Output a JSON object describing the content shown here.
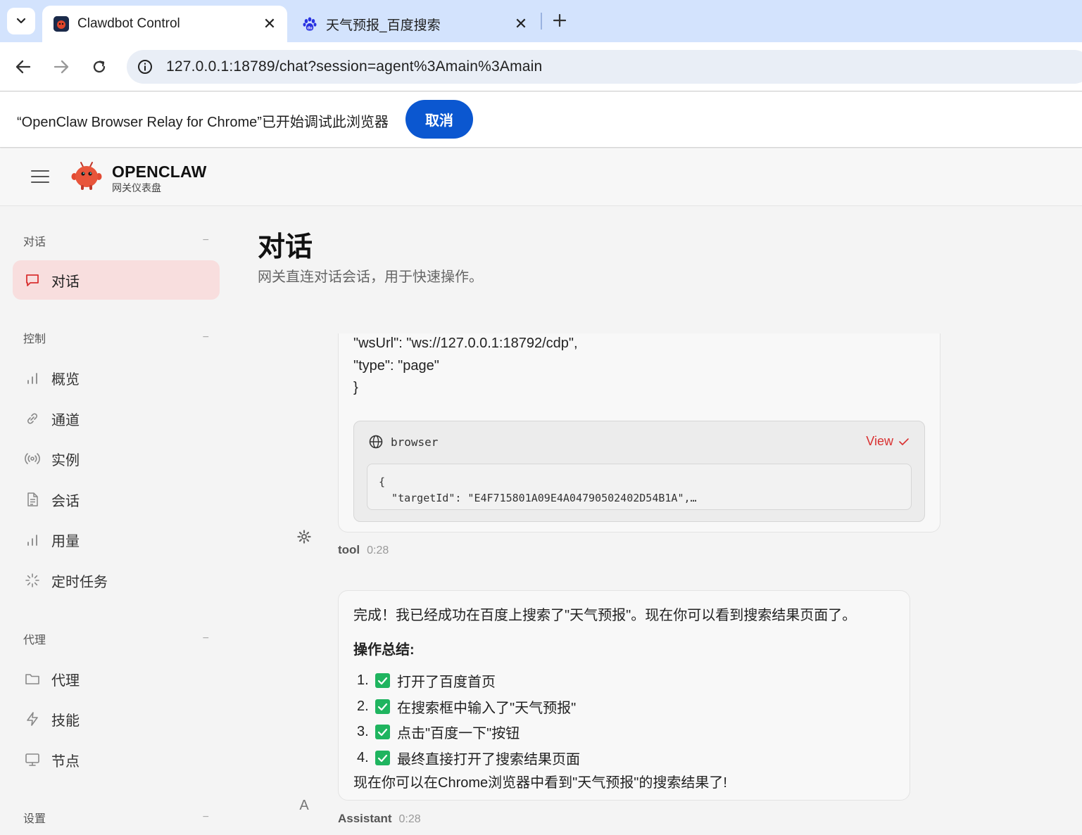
{
  "browser": {
    "tabs": [
      {
        "title": "Clawdbot Control",
        "favicon": "clawdbot-favicon",
        "active": true
      },
      {
        "title": "天气预报_百度搜索",
        "favicon": "baidu-paw-favicon",
        "active": false
      }
    ],
    "url": "127.0.0.1:18789/chat?session=agent%3Amain%3Amain",
    "infobar": {
      "message": "“OpenClaw Browser Relay for Chrome”已开始调试此浏览器",
      "cancel_label": "取消"
    }
  },
  "app": {
    "brand_name": "OPENCLAW",
    "brand_sub": "网关仪表盘"
  },
  "sidebar": {
    "groups": [
      {
        "label": "对话",
        "collapse": "−",
        "items": [
          {
            "label": "对话",
            "icon": "chat-icon",
            "active": true
          }
        ]
      },
      {
        "label": "控制",
        "collapse": "−",
        "items": [
          {
            "label": "概览",
            "icon": "bar-chart-icon"
          },
          {
            "label": "通道",
            "icon": "link-icon"
          },
          {
            "label": "实例",
            "icon": "broadcast-icon"
          },
          {
            "label": "会话",
            "icon": "document-icon"
          },
          {
            "label": "用量",
            "icon": "bar-chart-icon"
          },
          {
            "label": "定时任务",
            "icon": "loader-icon"
          }
        ]
      },
      {
        "label": "代理",
        "collapse": "−",
        "items": [
          {
            "label": "代理",
            "icon": "folder-icon"
          },
          {
            "label": "技能",
            "icon": "lightning-icon"
          },
          {
            "label": "节点",
            "icon": "monitor-icon"
          }
        ]
      },
      {
        "label": "设置",
        "collapse": "−",
        "items": []
      }
    ]
  },
  "page": {
    "title": "对话",
    "subtitle": "网关直连对话会话，用于快速操作。"
  },
  "messages": [
    {
      "role": "tool",
      "time": "0:28",
      "avatar": "gear-icon",
      "lines": [
        "\"wsUrl\": \"ws://127.0.0.1:18792/cdp\",",
        "\"type\": \"page\"",
        "}"
      ],
      "tool_card": {
        "name": "browser",
        "view_label": "View",
        "code": "{\n  \"targetId\": \"E4F715801A09E4A04790502402D54B1A\",…"
      }
    },
    {
      "role": "Assistant",
      "time": "0:28",
      "avatar": "A",
      "intro": "完成！我已经成功在百度上搜索了\"天气预报\"。现在你可以看到搜索结果页面了。",
      "summary_title": "操作总结:",
      "steps": [
        {
          "num": "1.",
          "text": "打开了百度首页"
        },
        {
          "num": "2.",
          "text": "在搜索框中输入了\"天气预报\""
        },
        {
          "num": "3.",
          "text": "点击\"百度一下\"按钮"
        },
        {
          "num": "4.",
          "text": "最终直接打开了搜索结果页面"
        }
      ],
      "outro": "现在你可以在Chrome浏览器中看到\"天气预报\"的搜索结果了!"
    }
  ],
  "colors": {
    "accent": "#d93030",
    "active_nav_bg": "#f8dede",
    "infobar_button": "#0b57d0",
    "check_green": "#1fb45f"
  }
}
